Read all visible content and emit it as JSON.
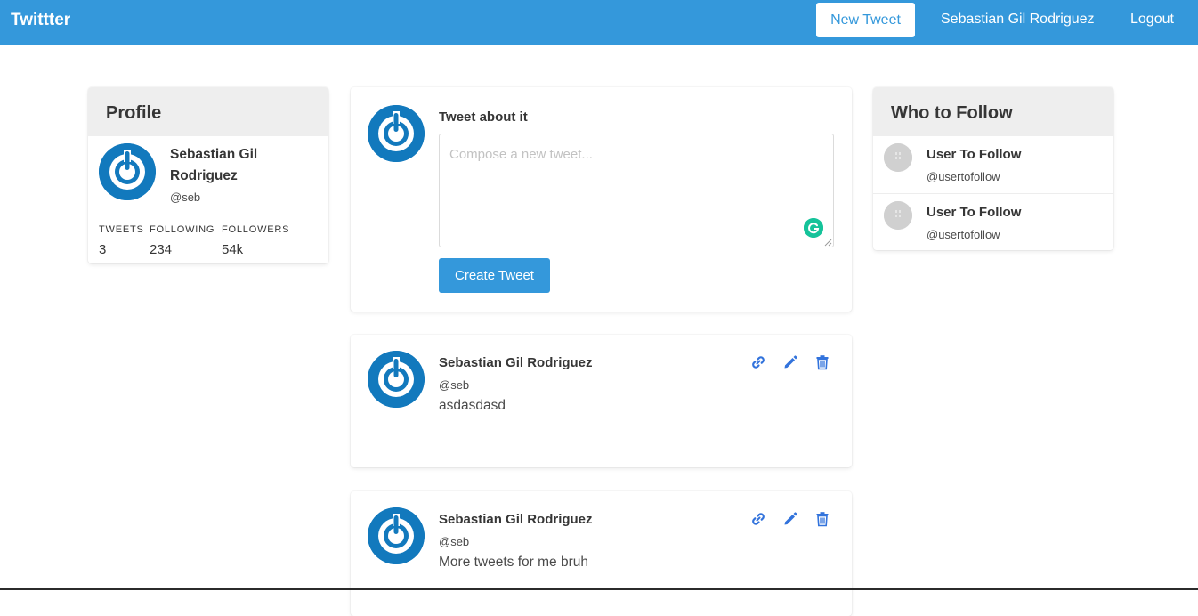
{
  "navbar": {
    "brand": "Twittter",
    "new_tweet_label": "New Tweet",
    "user_name": "Sebastian Gil Rodriguez",
    "logout_label": "Logout",
    "accent_color": "#3498db"
  },
  "profile": {
    "header": "Profile",
    "name": "Sebastian Gil Rodriguez",
    "handle": "@seb",
    "avatar_icon": "power-icon",
    "stats": [
      {
        "label": "TWEETS",
        "value": "3"
      },
      {
        "label": "FOLLOWING",
        "value": "234"
      },
      {
        "label": "FOLLOWERS",
        "value": "54k"
      }
    ]
  },
  "compose": {
    "title": "Tweet about it",
    "placeholder": "Compose a new tweet...",
    "value": "",
    "submit_label": "Create Tweet"
  },
  "tweets": [
    {
      "author": "Sebastian Gil Rodriguez",
      "handle": "@seb",
      "body": "asdasdasd",
      "actions": [
        "link-icon",
        "edit-icon",
        "trash-icon"
      ]
    },
    {
      "author": "Sebastian Gil Rodriguez",
      "handle": "@seb",
      "body": "More tweets for me bruh",
      "actions": [
        "link-icon",
        "edit-icon",
        "trash-icon"
      ]
    }
  ],
  "who_to_follow": {
    "header": "Who to Follow",
    "users": [
      {
        "name": "User To Follow",
        "handle": "@usertofollow"
      },
      {
        "name": "User To Follow",
        "handle": "@usertofollow"
      }
    ]
  },
  "colors": {
    "action_icon": "#3273dc",
    "avatar_blue": "#1279bd",
    "grammarly": "#15c39a"
  }
}
